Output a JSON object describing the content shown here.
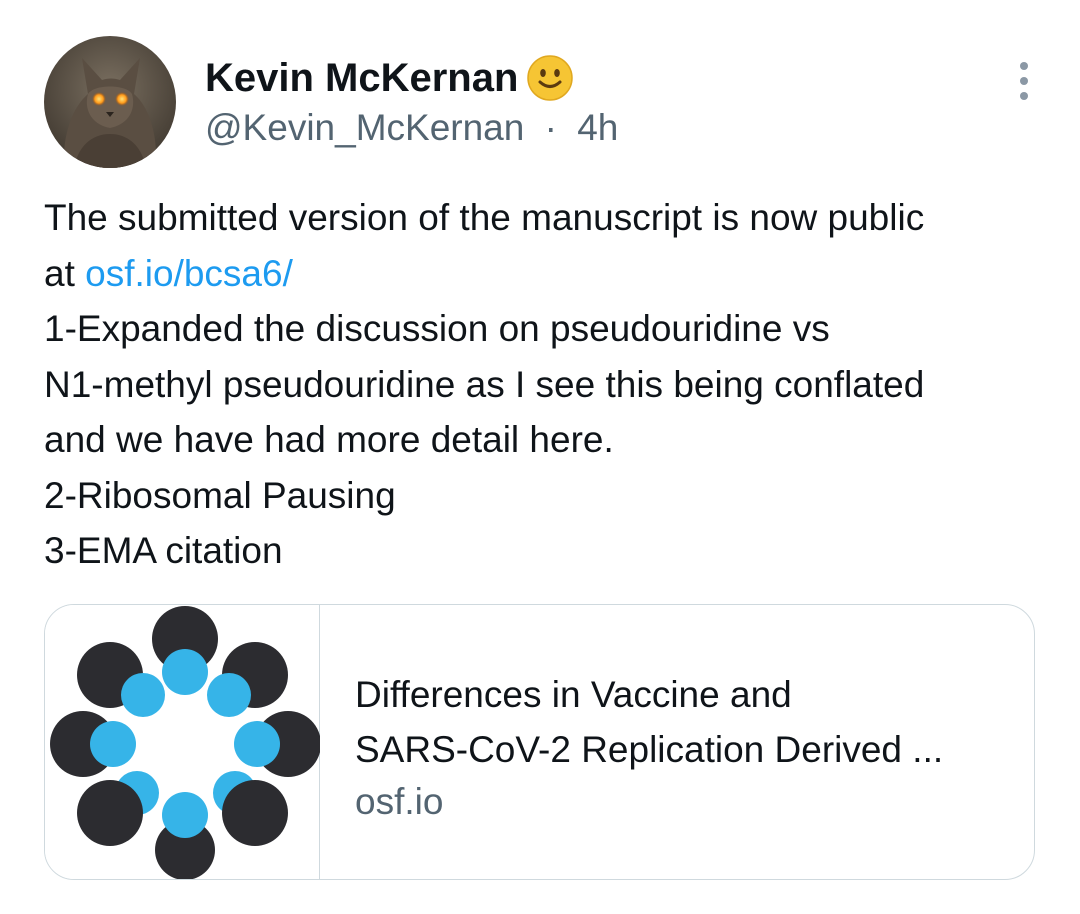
{
  "author": {
    "display_name": "Kevin McKernan",
    "emoji": "🙂",
    "handle": "@Kevin_McKernan",
    "separator": "·",
    "time": "4h"
  },
  "tweet": {
    "line1": "The submitted version of the manuscript is now public",
    "line2_prefix": "at ",
    "link_text": "osf.io/bcsa6/",
    "line3": "1-Expanded the discussion on pseudouridine vs",
    "line4": "N1-methyl pseudouridine as I see this being conflated",
    "line5": "and we have had more detail here.",
    "line6": "2-Ribosomal Pausing",
    "line7": "3-EMA citation"
  },
  "card": {
    "title_line1": "Differences in Vaccine and",
    "title_line2": "SARS-CoV-2 Replication Derived ...",
    "domain": "osf.io"
  },
  "icons": {
    "more": "more-vertical-icon",
    "avatar": "avatar-cat-image",
    "thumbnail": "osf-logo-circles"
  },
  "colors": {
    "text": "#0f1419",
    "secondary": "#536471",
    "link": "#1d9bf0",
    "border": "#cfd9de",
    "logo_dark": "#2c2c30",
    "logo_blue": "#36b4e8",
    "emoji_yellow": "#f6c534"
  }
}
